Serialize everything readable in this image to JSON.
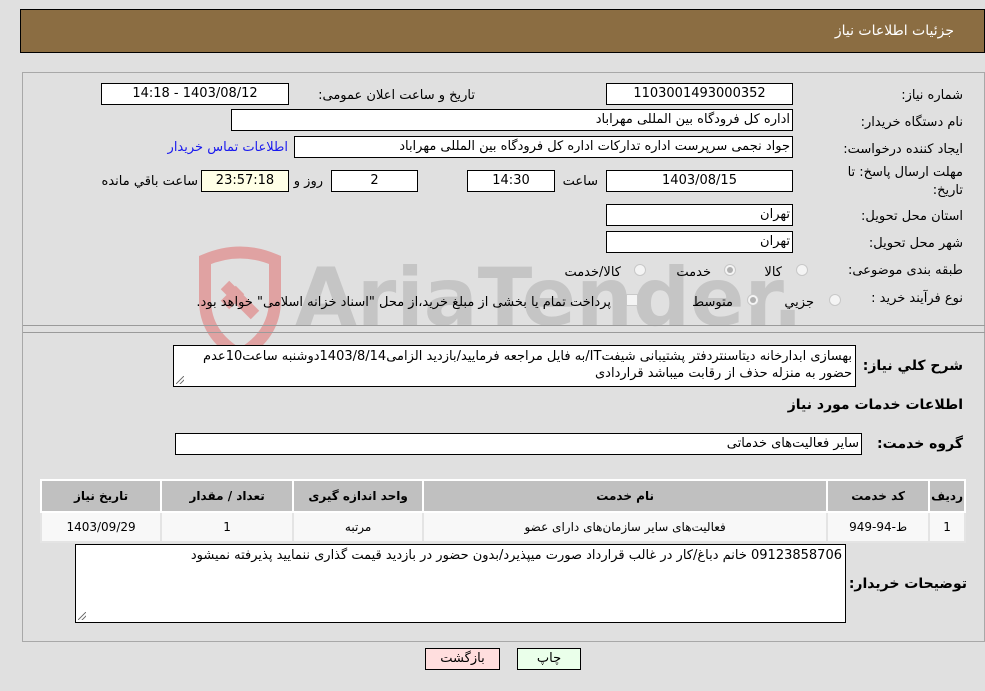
{
  "header": {
    "title": "جزئیات اطلاعات نیاز"
  },
  "form": {
    "need_number": {
      "label": "شماره نیاز:",
      "value": "1103001493000352"
    },
    "announce_datetime": {
      "label": "تاریخ و ساعت اعلان عمومی:",
      "value": "1403/08/12 - 14:18"
    },
    "buyer_org": {
      "label": "نام دستگاه خریدار:",
      "value": "اداره کل فرودگاه بین المللی مهراباد"
    },
    "requester": {
      "label": "ایجاد کننده درخواست:",
      "value": "جواد نجمی سرپرست اداره تدارکات  اداره کل فرودگاه بین المللی مهراباد"
    },
    "buyer_contact_link": "اطلاعات تماس خریدار",
    "deadline": {
      "label_line1": "مهلت ارسال پاسخ: تا",
      "label_line2": "تاریخ:",
      "date": "1403/08/15",
      "time_label": "ساعت",
      "time": "14:30",
      "days": "2",
      "days_label": "روز و",
      "remaining": "23:57:18",
      "remaining_label": "ساعت باقي مانده"
    },
    "province": {
      "label": "استان محل تحویل:",
      "value": "تهران"
    },
    "city": {
      "label": "شهر محل تحویل:",
      "value": "تهران"
    },
    "category": {
      "label": "طبقه بندی موضوعی:",
      "options": [
        "کالا",
        "خدمت",
        "کالا/خدمت"
      ],
      "selected": "خدمت"
    },
    "purchase_type": {
      "label": "نوع فرآیند خرید :",
      "options": [
        "جزيي",
        "متوسط"
      ],
      "selected": "متوسط",
      "treasury_note": "پرداخت تمام یا بخشی از مبلغ خرید،از محل \"اسناد خزانه اسلامی\" خواهد بود."
    },
    "description": {
      "label": "شرح کلي نیاز:",
      "value": "بهسازی ابدارخانه دیتاسنتردفتر پشتیبانی شیفتIT/به فایل مراجعه فرمایید/بازدید الزامی1403/8/14دوشنبه ساعت10عدم حضور به منزله حذف از رقابت میباشد قراردادی"
    }
  },
  "services": {
    "section_title": "اطلاعات خدمات مورد نیاز",
    "group_label": "گروه خدمت:",
    "group_value": "سایر فعالیت‌های خدماتی",
    "table": {
      "headers": [
        "ردیف",
        "کد خدمت",
        "نام خدمت",
        "واحد اندازه گیری",
        "تعداد / مقدار",
        "تاریخ نیاز"
      ],
      "rows": [
        [
          "1",
          "ط-94-949",
          "فعالیت‌های سایر سازمان‌های دارای عضو",
          "مرتبه",
          "1",
          "1403/09/29"
        ]
      ]
    }
  },
  "buyer_notes": {
    "label": "توضیحات خریدار:",
    "value": "09123858706 خانم دباغ/کار در غالب قرارداد صورت میپذیرد/بدون حضور در بازدید قیمت گذاری ننمایید پذیرفته نمیشود"
  },
  "buttons": {
    "print": "چاپ",
    "back": "بازگشت"
  },
  "colors": {
    "header_bg": "#8b6d42",
    "print_bg": "#eaffea",
    "back_bg": "#ffdede",
    "link": "#1a1aee",
    "remaining_bg": "#ffffe6"
  },
  "watermark": "AriaTender.neT"
}
